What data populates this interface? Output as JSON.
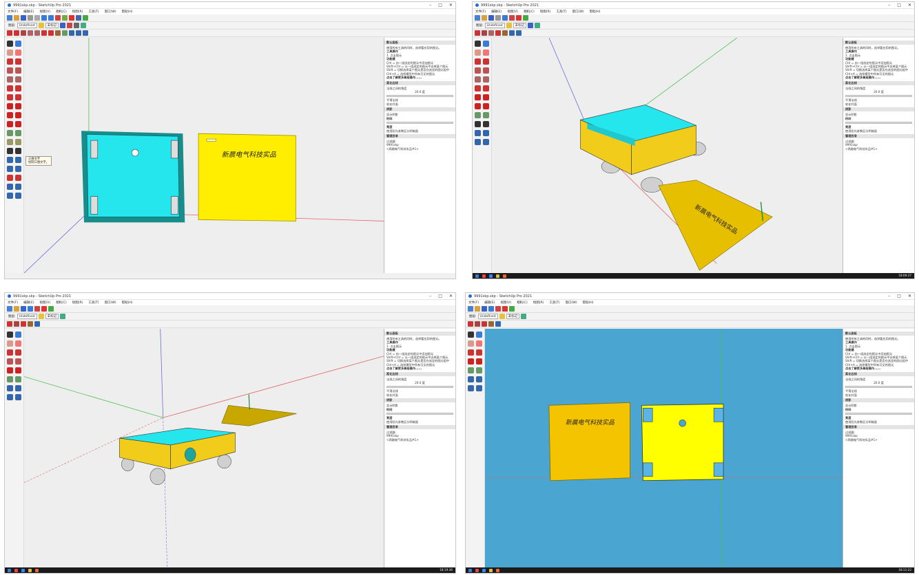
{
  "window": {
    "title": "9991skp.skp - SketchUp Pro 2021",
    "controls": [
      "–",
      "□",
      "✕"
    ]
  },
  "menu": [
    "文件(F)",
    "编辑(E)",
    "视图(V)",
    "相机(C)",
    "绘图(R)",
    "工具(T)",
    "窗口(W)",
    "帮助(H)"
  ],
  "toolbar": {
    "layer_label": "图层:",
    "layer_value": "Undefined",
    "tag_value": "未标记"
  },
  "tray": {
    "title": "默认面板",
    "instructor_line": "使用所有工具的同时，选择要应用的图元。",
    "tool_ops_title": "工具操作",
    "tool_ops_text": "1. 点击图元",
    "modifier_title": "功能键",
    "modifier_lines": [
      "Ctrl = 向一组选定的图元中添加图元",
      "Shift+Ctrl = 从一组选定的图元中去掉某个图元",
      "Shift = 切换选择某个图元是否在选定的图元组中",
      "Ctrl+A = 选择模型中所有可见的图元"
    ],
    "more_link": "点击了解更多高级操作......",
    "soften_title": "柔化边线",
    "soften_text": "法线之间的角度",
    "soften_value": "20.0 度",
    "soften_opts": [
      "平滑法线",
      "软化共面"
    ],
    "shadow_title": "阴影",
    "shadow_show": "显示阴影",
    "shadow_time_label": "时间",
    "shadow_times": [
      "06:43",
      "中午",
      "04:46"
    ],
    "color_label": "亮度",
    "use_sun": "使用阳光参数区分明暗面",
    "outliner_title": "管理目录",
    "filter_label": "过滤器:",
    "outliner_model": "9991skp",
    "outliner_item": "<两路电气科技实品#1>"
  },
  "tooltip": {
    "title": "三维文字",
    "desc": "绘制三维文字。"
  },
  "clocks": [
    "",
    "18:09:37",
    "18:19:36",
    "18:11:22"
  ],
  "sign_text": "新晨电气科技实品",
  "colors": {
    "cyan": "#24e6ec",
    "yellow": "#ffee00",
    "blue_bg": "#4aa5d1",
    "viewport": "#eeeeee"
  }
}
